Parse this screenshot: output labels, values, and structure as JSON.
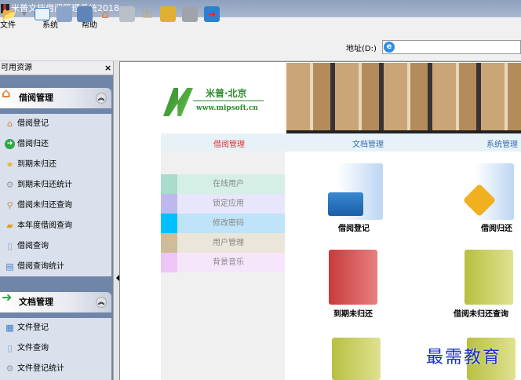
{
  "window": {
    "title": "米普文档借阅管理系统2018"
  },
  "menu": [
    "文件",
    "系统",
    "帮助"
  ],
  "toolbar": {
    "address_label": "地址(D:)",
    "address_value": "",
    "icons": [
      "open-folder-icon",
      "list-view-icon",
      "computer-icon",
      "spreadsheet-icon",
      "home-icon",
      "printer-icon",
      "keys-icon",
      "lock-icon",
      "user-lock-icon",
      "exit-door-icon"
    ]
  },
  "left_panel": {
    "title": "可用资源",
    "close": "×",
    "groups": [
      {
        "title": "借阅管理",
        "items": [
          "借阅登记",
          "借阅归还",
          "到期未归还",
          "到期未归还统计",
          "借阅未归还查询",
          "本年度借阅查询",
          "借阅查询",
          "借阅查询统计"
        ]
      },
      {
        "title": "文档管理",
        "items": [
          "文件登记",
          "文件查询",
          "文件登记统计"
        ]
      }
    ]
  },
  "logo": {
    "name": "米普·北京",
    "url": "www.mipsoft.cn"
  },
  "tabs": [
    {
      "label": "借阅管理",
      "color": "#e03030"
    },
    {
      "label": "文档管理",
      "color": "#3b6fb0"
    },
    {
      "label": "系统管理",
      "color": "#3b6fb0"
    }
  ],
  "side_menu": [
    {
      "label": "在线用户",
      "swatch": "#a8dccb",
      "bg": "#d6efe6"
    },
    {
      "label": "锁定应用",
      "swatch": "#bdb8ee",
      "bg": "#e8e6fb"
    },
    {
      "label": "修改密码",
      "swatch": "#00c0ff",
      "bg": "#bfe3f8"
    },
    {
      "label": "用户管理",
      "swatch": "#cdbd98",
      "bg": "#ebe6d9"
    },
    {
      "label": "背景音乐",
      "swatch": "#eec6f6",
      "bg": "#f6e6fb"
    }
  ],
  "functions": [
    "借阅登记",
    "借阅归还",
    "到期未归还",
    "借阅未归还查询"
  ],
  "watermark": "最需教育"
}
